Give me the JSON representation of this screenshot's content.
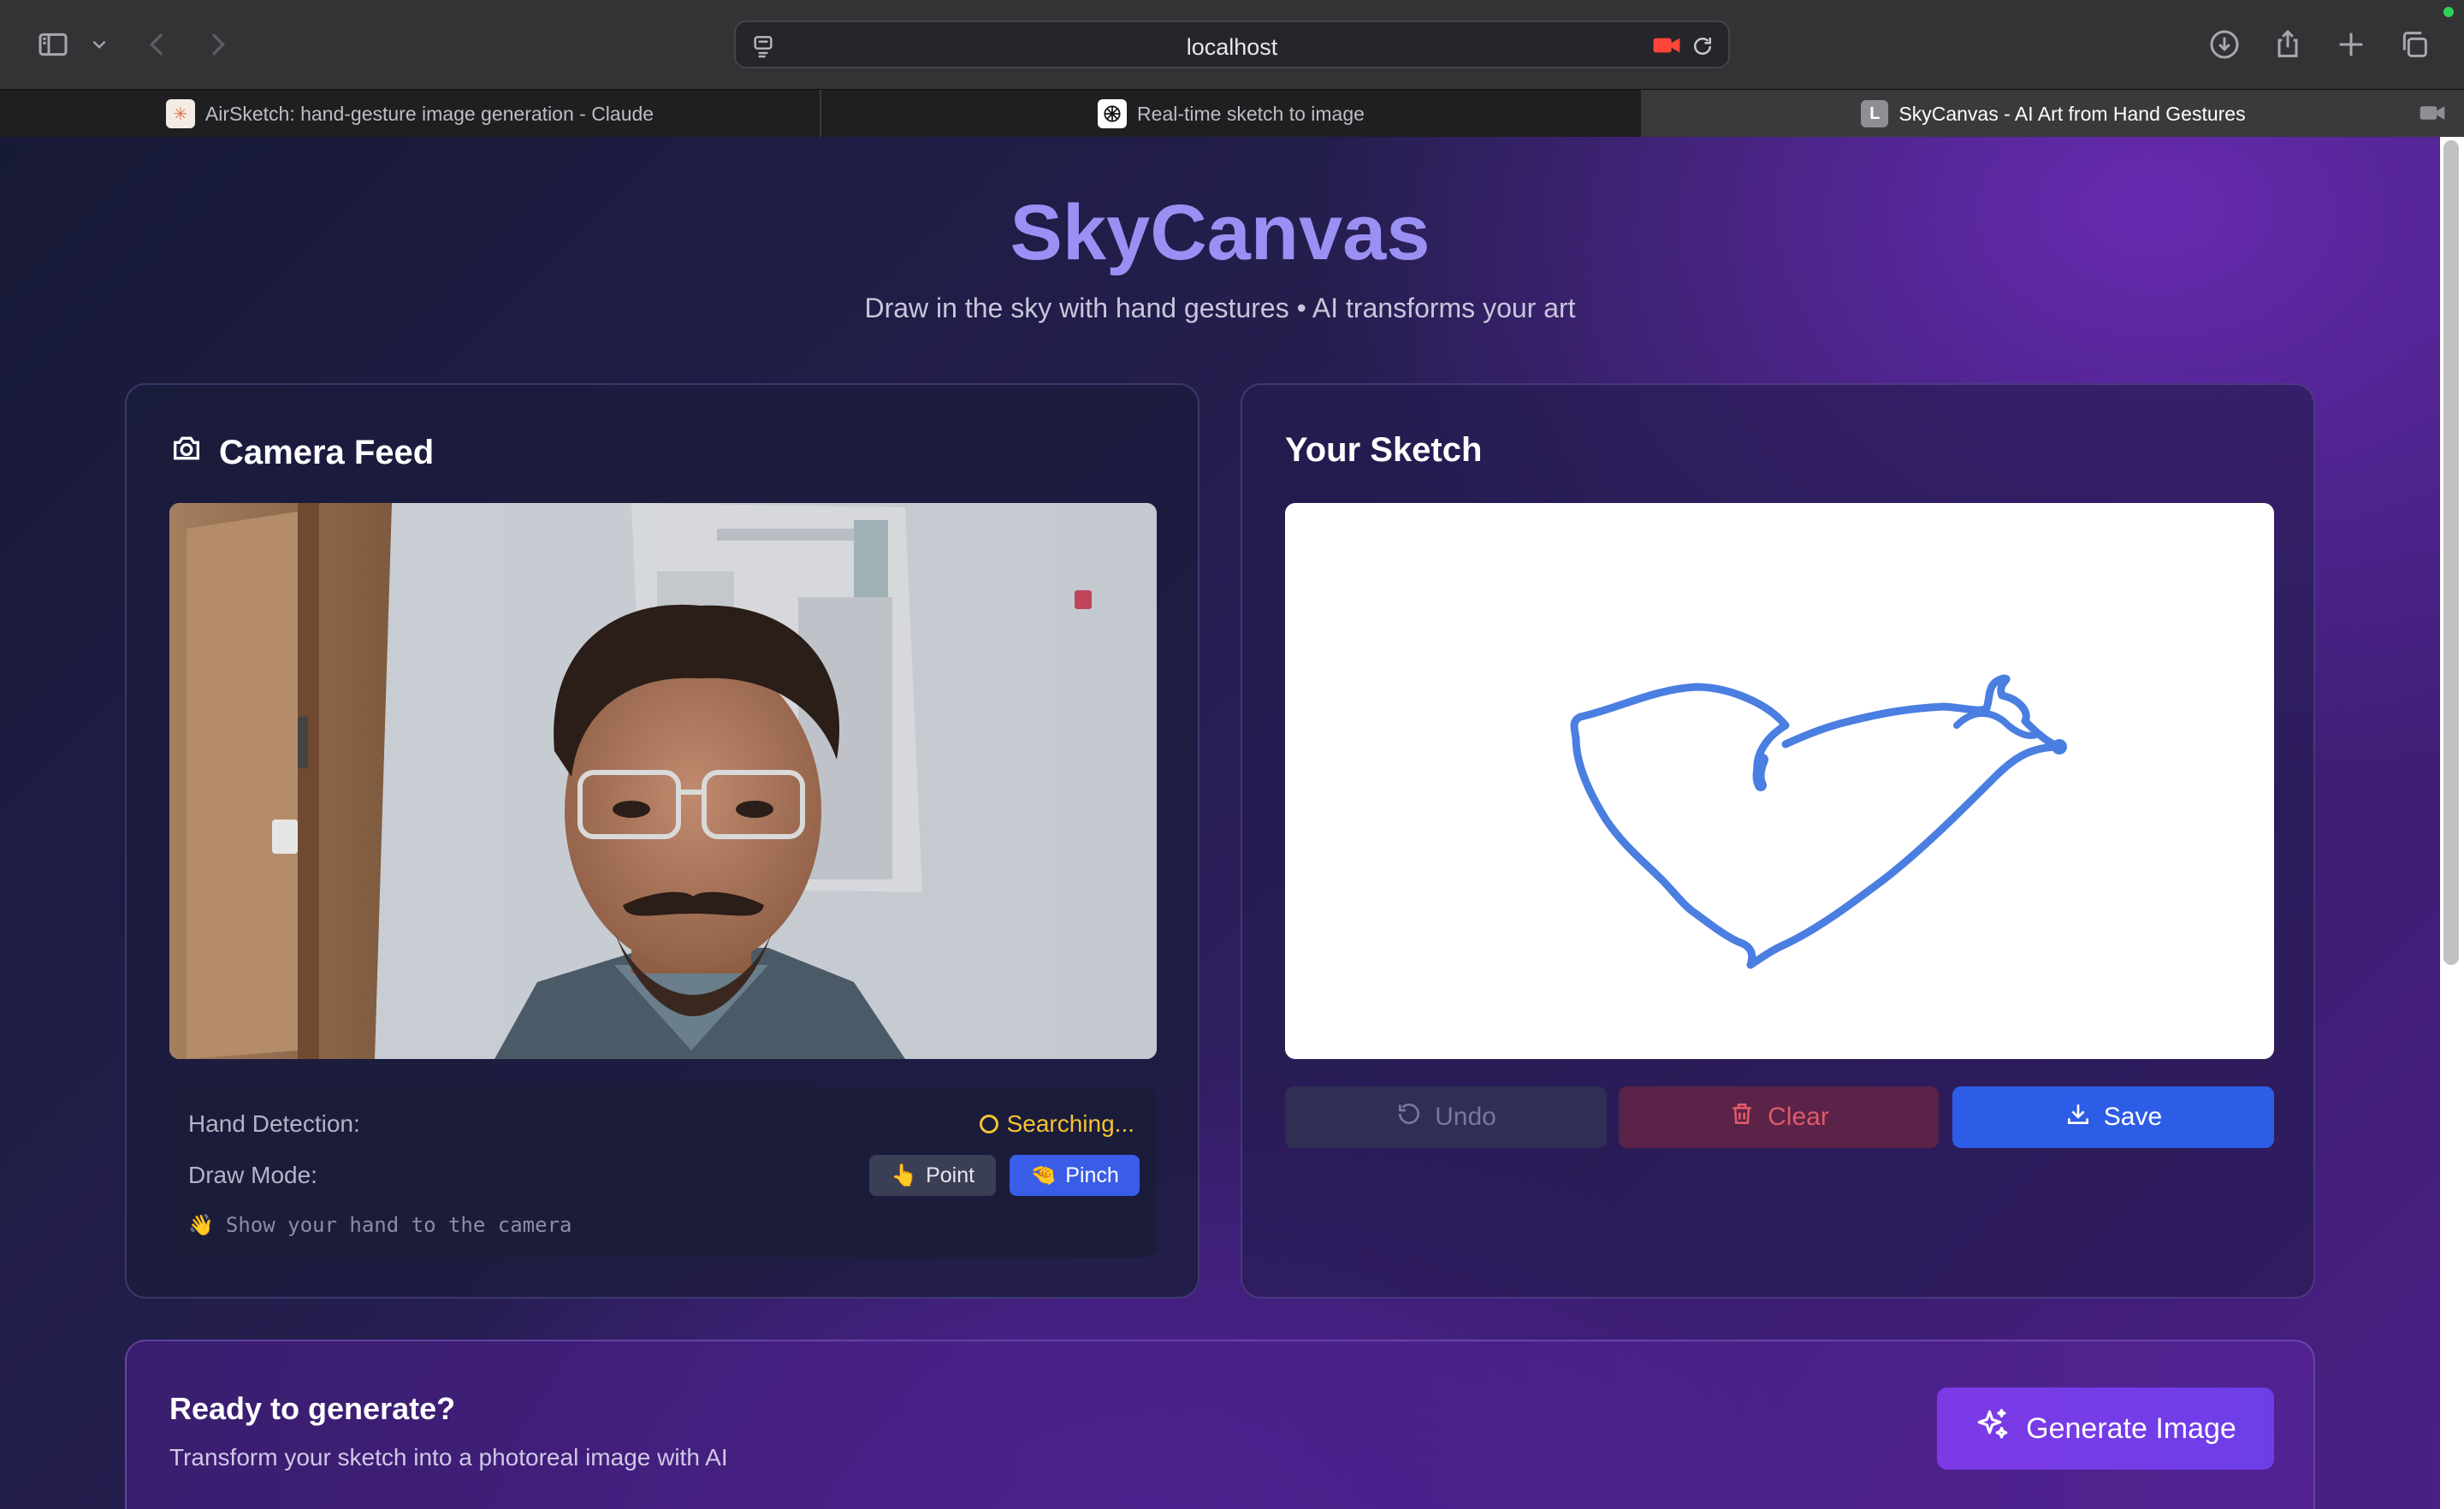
{
  "browser": {
    "address": "localhost",
    "tabs": [
      {
        "title": "AirSketch: hand-gesture image generation - Claude",
        "active": false
      },
      {
        "title": "Real-time sketch to image",
        "active": false
      },
      {
        "title": "SkyCanvas - AI Art from Hand Gestures",
        "active": true,
        "favicon_letter": "L"
      }
    ]
  },
  "app": {
    "title": "SkyCanvas",
    "subtitle": "Draw in the sky with hand gestures • AI transforms your art"
  },
  "camera": {
    "title": "Camera Feed",
    "hand_detection_label": "Hand Detection:",
    "hand_detection_status": "Searching...",
    "draw_mode_label": "Draw Mode:",
    "modes": [
      {
        "label": "Point",
        "emoji": "👆",
        "active": false
      },
      {
        "label": "Pinch",
        "emoji": "🤏",
        "active": true
      }
    ],
    "hint": "Show your hand to the camera",
    "hint_emoji": "👋"
  },
  "sketch": {
    "title": "Your Sketch",
    "stroke_color": "#4a7ee0",
    "buttons": {
      "undo": "Undo",
      "clear": "Clear",
      "save": "Save"
    }
  },
  "generate": {
    "title": "Ready to generate?",
    "subtitle": "Transform your sketch into a photoreal image with AI",
    "button": "Generate Image"
  },
  "colors": {
    "title_accent": "#9a90f4",
    "searching": "#f5c333",
    "primary": "#2d5de6",
    "generate": "#7c3ae6"
  }
}
